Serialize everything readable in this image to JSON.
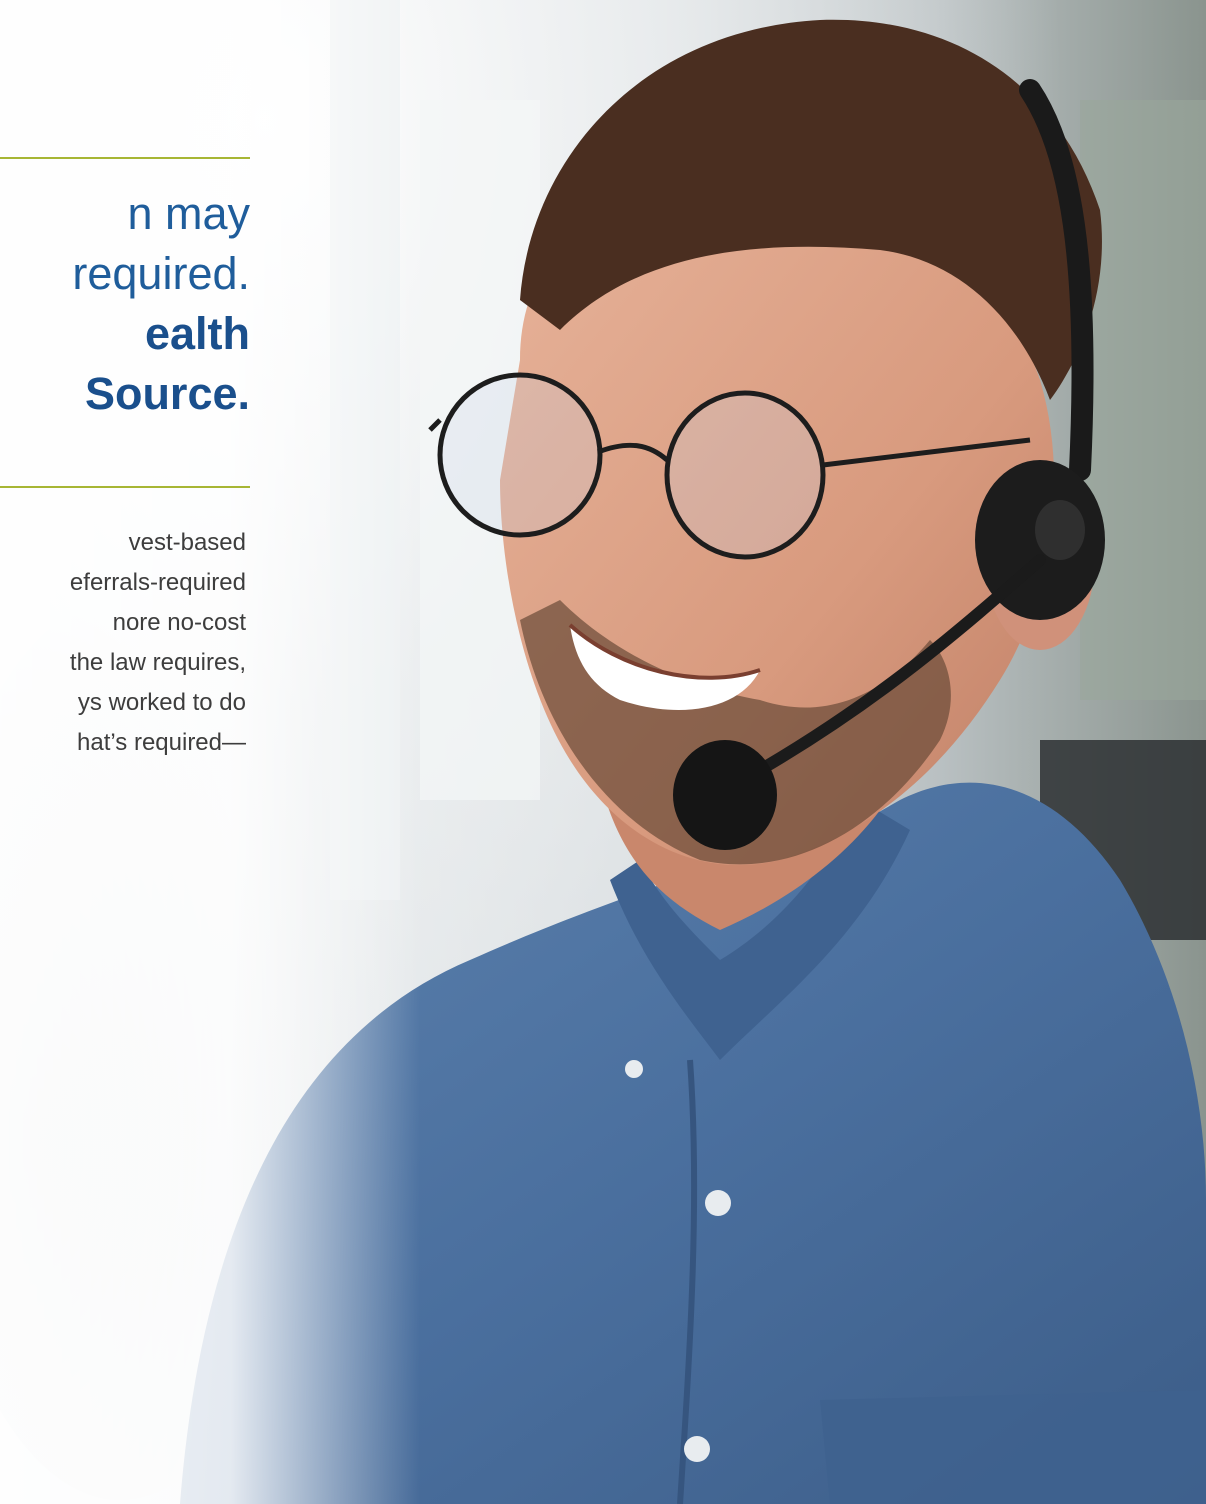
{
  "headline": {
    "line1": "n may",
    "line2": "required.",
    "line3": "ealth",
    "line4": "Source."
  },
  "body_lines": [
    "vest-based",
    "eferrals-required",
    "nore no-cost",
    "the law requires,",
    "ys worked to do",
    "hat’s required—"
  ],
  "colors": {
    "headline_blue": "#1f5d9b",
    "accent_rule": "#a7b634",
    "shirt_blue": "#4a6f9e"
  },
  "image": {
    "subject": "man-with-headset-icon"
  }
}
